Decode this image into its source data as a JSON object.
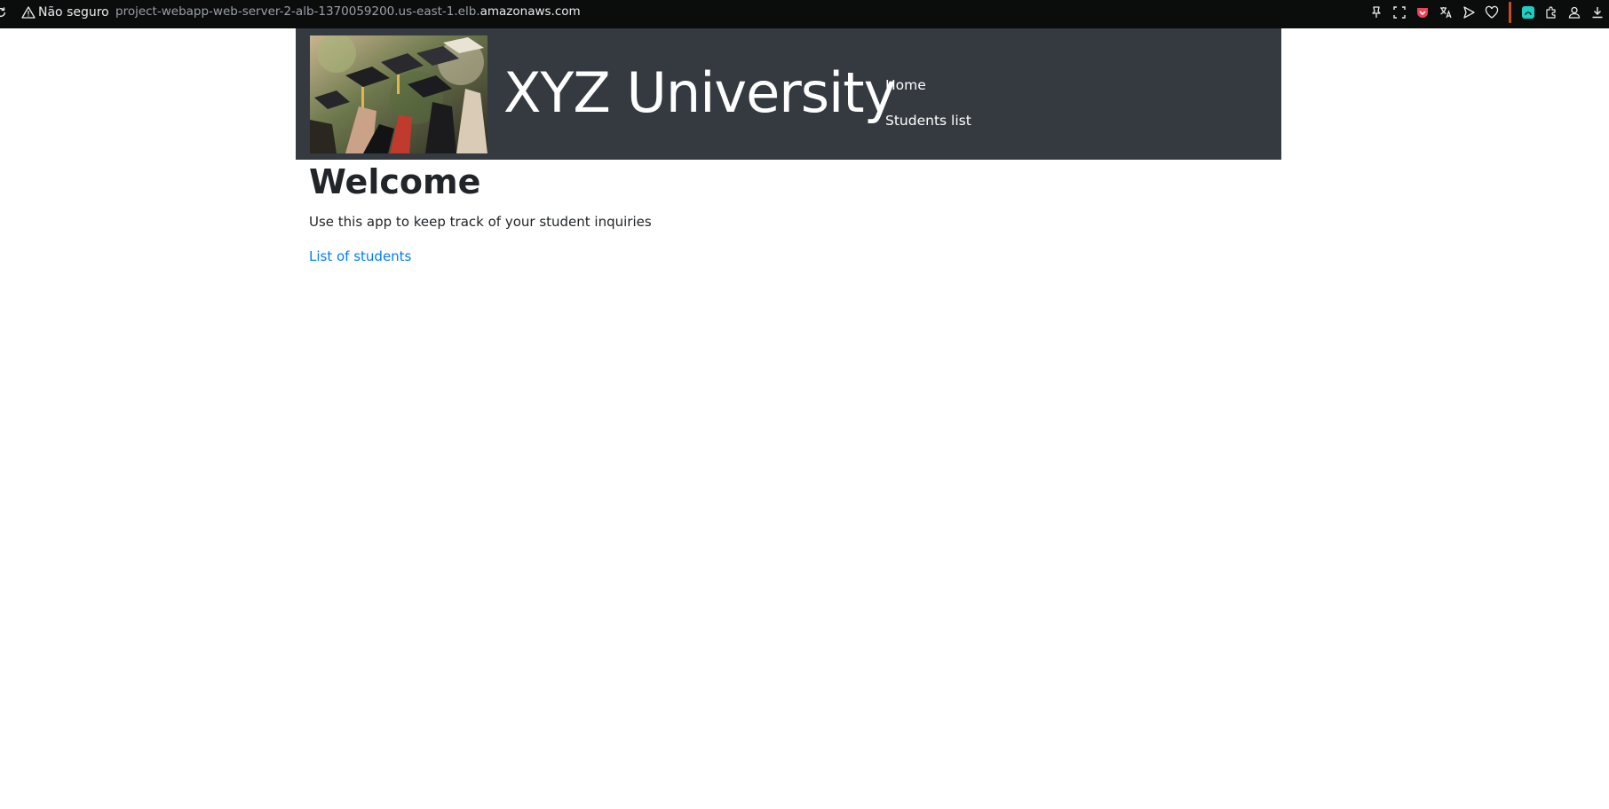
{
  "browser": {
    "security_label": "Não seguro",
    "url_path": "project-webapp-web-server-2-alb-1370059200.us-east-1.elb.",
    "url_host": "amazonaws.com",
    "toolbar_icons": [
      "pin-icon",
      "screenshot-icon",
      "pocket-icon",
      "translate-icon",
      "send-icon",
      "heart-icon",
      "extension-app-icon",
      "puzzle-icon",
      "profile-icon",
      "download-icon"
    ],
    "accent_color": "#c2501f"
  },
  "header": {
    "banner_alt": "graduation caps",
    "site_title": "XYZ University",
    "background_color": "#343a40",
    "nav": [
      {
        "label": "Home"
      },
      {
        "label": "Students list"
      }
    ]
  },
  "main": {
    "title": "Welcome",
    "intro": "Use this app to keep track of your student inquiries",
    "link_label": "List of students",
    "link_color": "#007bff"
  }
}
